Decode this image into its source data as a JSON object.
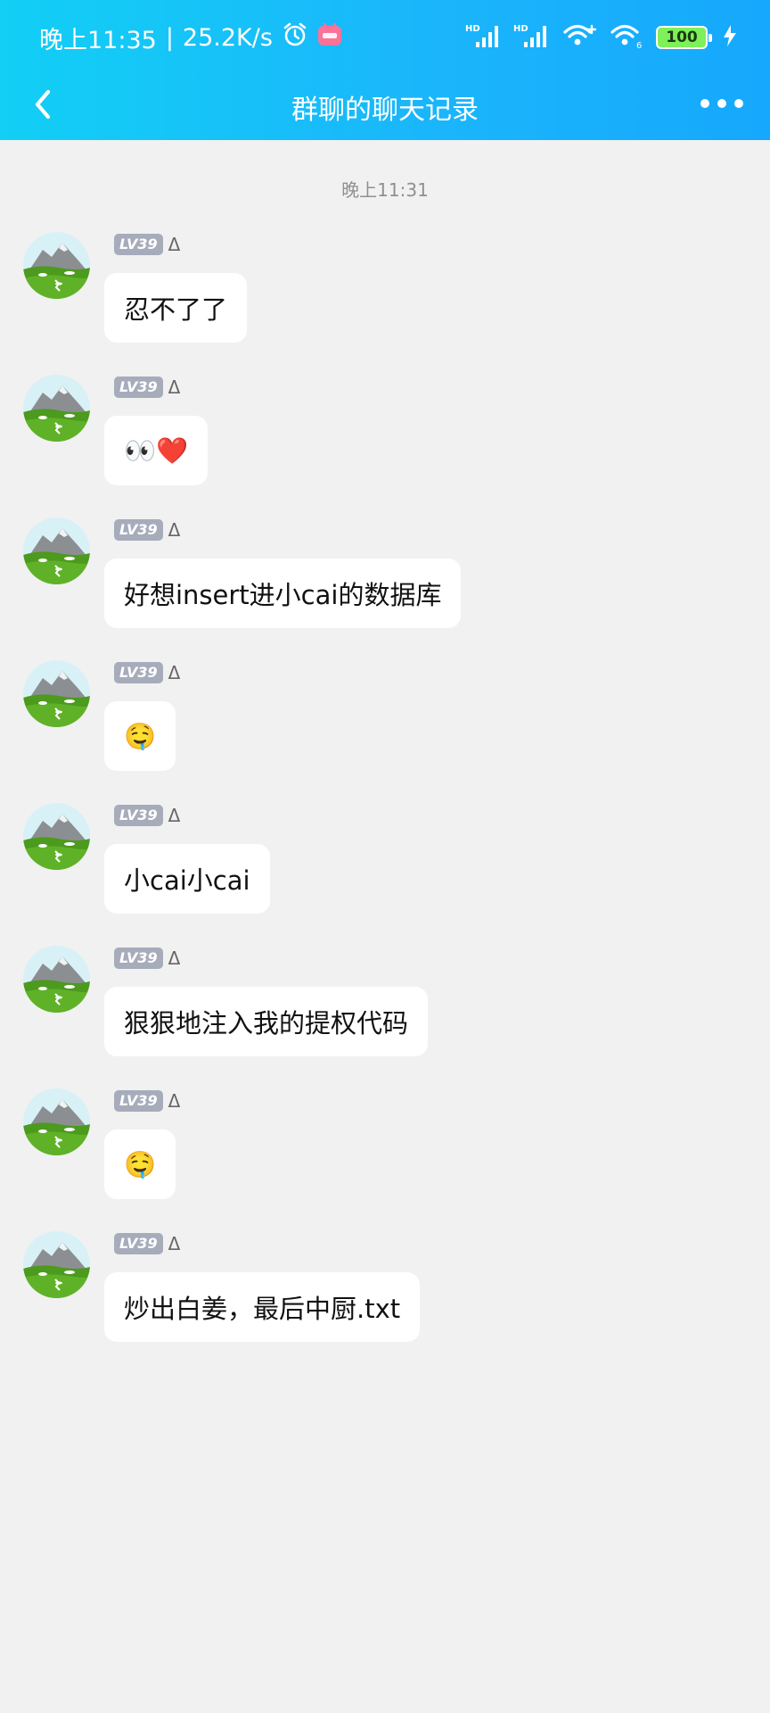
{
  "status_bar": {
    "time": "晚上11:35",
    "net_speed": "25.2K/s",
    "battery": "100",
    "sig1_label": "HD",
    "sig2_label": "HD",
    "wifi2_sub": "6"
  },
  "nav": {
    "title": "群聊的聊天记录"
  },
  "chat": {
    "timestamp": "晚上11:31",
    "messages": [
      {
        "level": "LV39",
        "nick": "Δ",
        "text": "忍不了了"
      },
      {
        "level": "LV39",
        "nick": "Δ",
        "text": "👀❤️"
      },
      {
        "level": "LV39",
        "nick": "Δ",
        "text": "好想insert进小cai的数据库"
      },
      {
        "level": "LV39",
        "nick": "Δ",
        "text": "🤤"
      },
      {
        "level": "LV39",
        "nick": "Δ",
        "text": "小cai小cai"
      },
      {
        "level": "LV39",
        "nick": "Δ",
        "text": "狠狠地注入我的提权代码"
      },
      {
        "level": "LV39",
        "nick": "Δ",
        "text": "🤤"
      },
      {
        "level": "LV39",
        "nick": "Δ",
        "text": "炒出白姜，最后中厨.txt"
      }
    ]
  }
}
